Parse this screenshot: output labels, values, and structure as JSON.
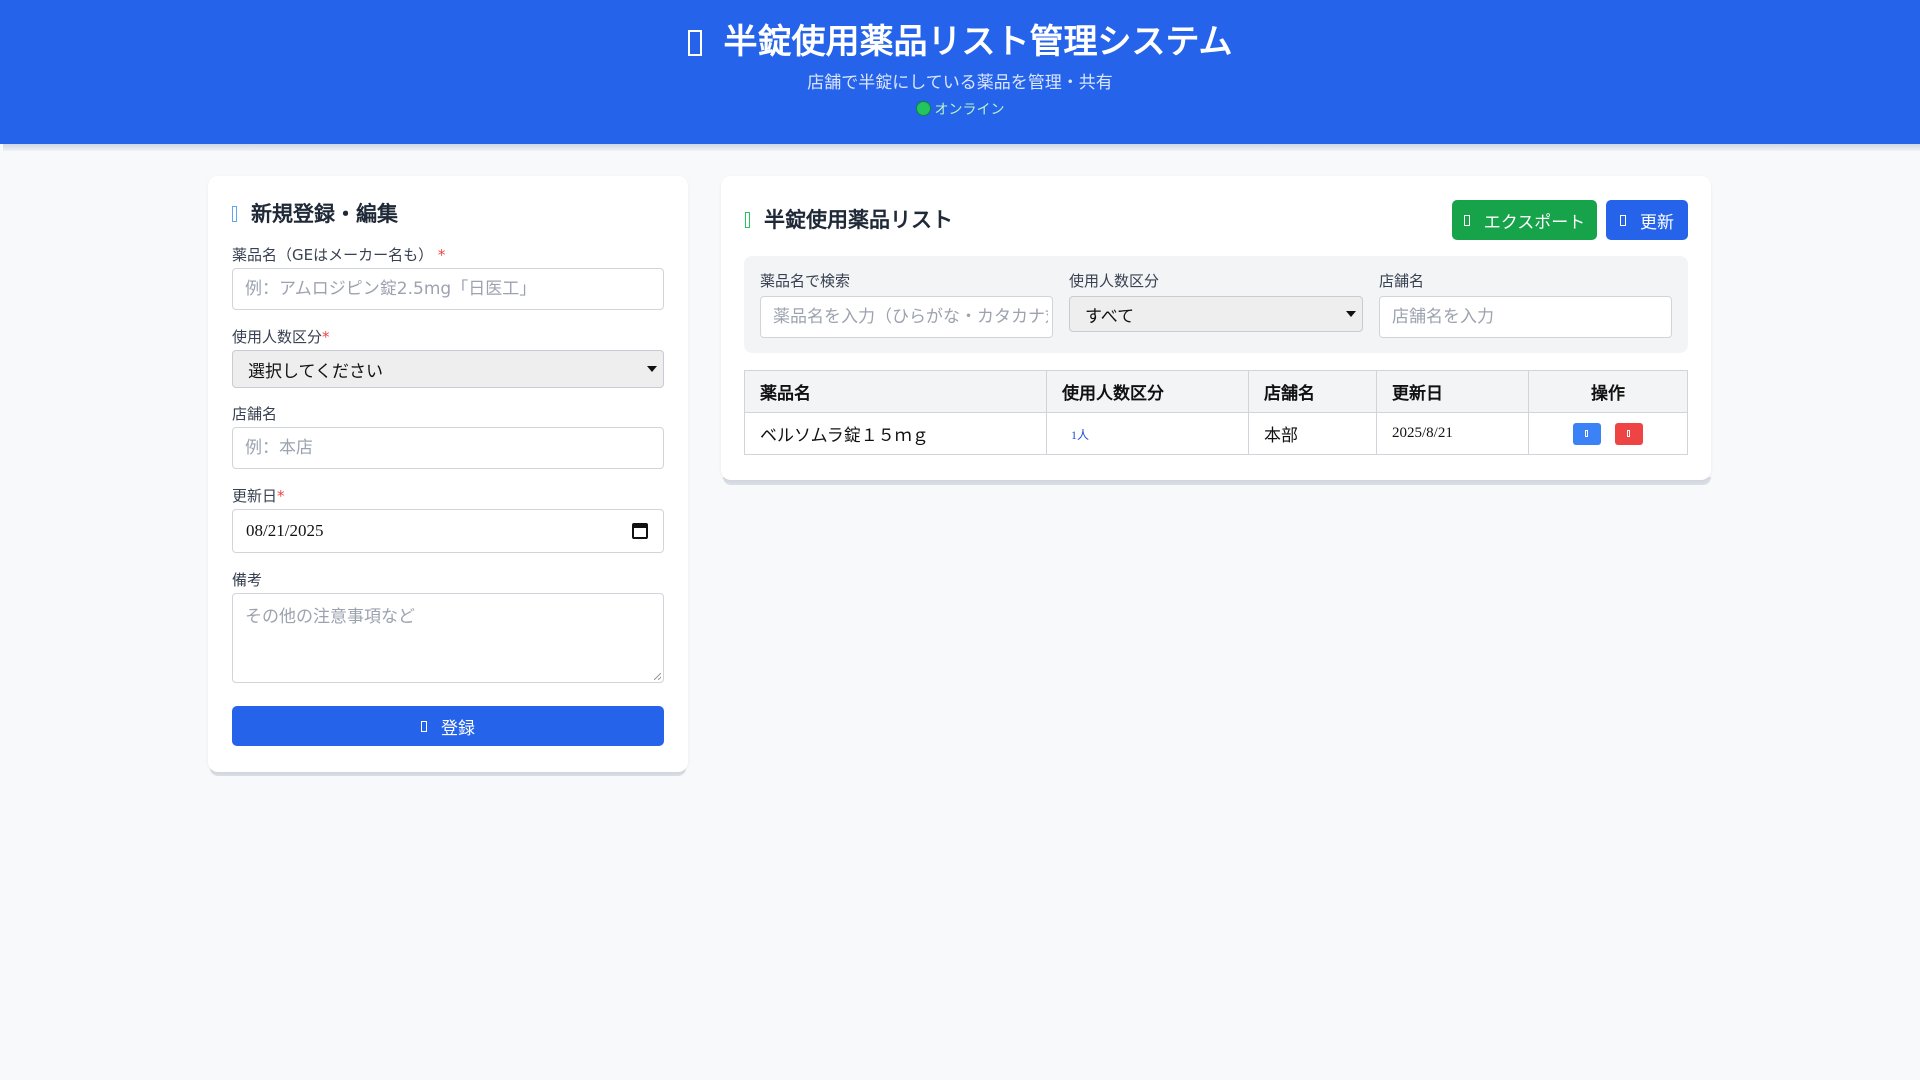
{
  "header": {
    "title": "半錠使用薬品リスト管理システム",
    "subtitle": "店舗で半錠にしている薬品を管理・共有",
    "status": "オンライン",
    "title_icon": "pill-icon",
    "status_color": "#22c55e"
  },
  "colors": {
    "primary": "#2563eb",
    "success": "#16a34a",
    "danger": "#ef4444",
    "background": "#f8f9fb"
  },
  "form": {
    "title": "新規登録・編集",
    "icon": "edit-icon",
    "drug_name_label": "薬品名（GEはメーカー名も）",
    "drug_name_placeholder": "例：アムロジピン錠2.5mg「日医工」",
    "usage_label": "使用人数区分",
    "usage_selected": "選択してください",
    "store_label": "店舗名",
    "store_placeholder": "例：本店",
    "date_label": "更新日",
    "date_value": "08/21/2025",
    "notes_label": "備考",
    "notes_placeholder": "その他の注意事項など",
    "required_mark": "*",
    "submit_label": "登録"
  },
  "list": {
    "title": "半錠使用薬品リスト",
    "icon": "list-icon",
    "export_label": "エクスポート",
    "refresh_label": "更新",
    "filters": {
      "search_label": "薬品名で検索",
      "search_placeholder": "薬品名を入力（ひらがな・カタカナ対応）",
      "usage_label": "使用人数区分",
      "usage_selected": "すべて",
      "store_label": "店舗名",
      "store_placeholder": "店舗名を入力"
    },
    "columns": [
      "薬品名",
      "使用人数区分",
      "店舗名",
      "更新日",
      "操作"
    ],
    "rows": [
      {
        "drug_name": "ベルソムラ錠１５ｍｇ",
        "usage": "1人",
        "store": "本部",
        "date": "2025/8/21"
      }
    ]
  }
}
